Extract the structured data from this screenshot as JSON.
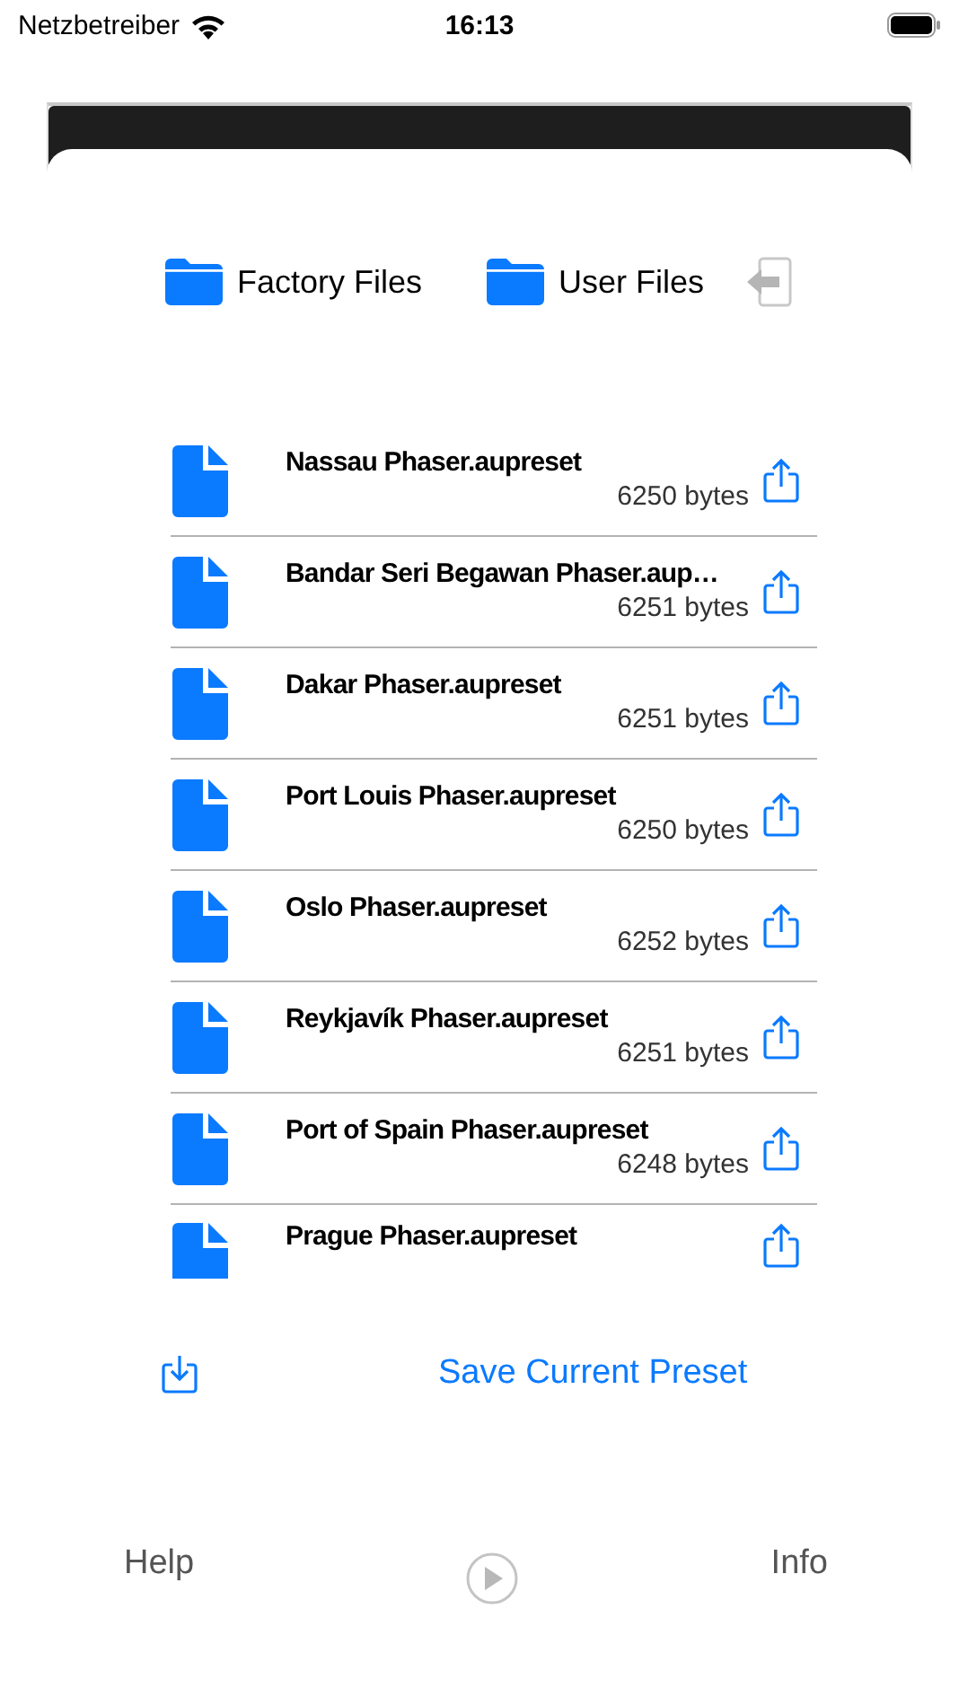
{
  "status_bar": {
    "carrier": "Netzbetreiber",
    "time": "16:13"
  },
  "sources": [
    {
      "label": "Factory Files"
    },
    {
      "label": "User Files"
    }
  ],
  "files": [
    {
      "name": "Nassau Phaser.aupreset",
      "size": "6250 bytes"
    },
    {
      "name": "Bandar Seri Begawan Phaser.aup…",
      "size": "6251 bytes"
    },
    {
      "name": "Dakar Phaser.aupreset",
      "size": "6251 bytes"
    },
    {
      "name": "Port Louis Phaser.aupreset",
      "size": "6250 bytes"
    },
    {
      "name": "Oslo Phaser.aupreset",
      "size": "6252 bytes"
    },
    {
      "name": "Reykjavík Phaser.aupreset",
      "size": "6251 bytes"
    },
    {
      "name": "Port of Spain Phaser.aupreset",
      "size": "6248 bytes"
    },
    {
      "name": "Prague Phaser.aupreset"
    }
  ],
  "save_button": "Save Current Preset",
  "bottom_bar": {
    "left": "Help",
    "right": "Info"
  }
}
